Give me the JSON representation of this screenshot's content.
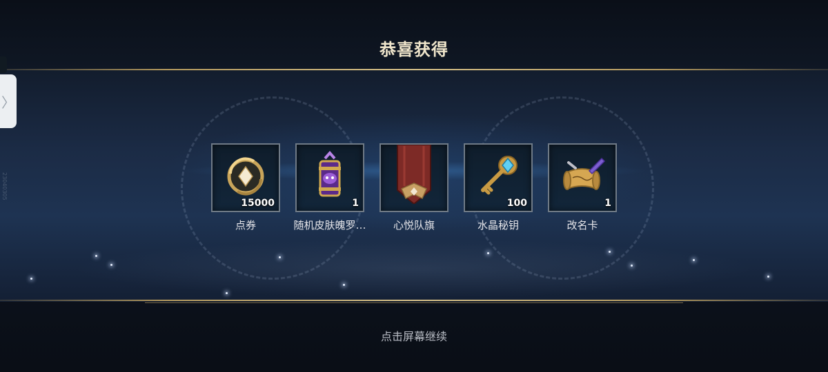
{
  "dialog": {
    "title": "恭喜获得",
    "continue_hint": "点击屏幕继续"
  },
  "watermark": "23040305",
  "side_tab": {
    "icon": "chevron-right-icon",
    "glyph": "〉"
  },
  "rewards": [
    {
      "name": "点券",
      "count": "15000",
      "icon": "coupon-coin-icon"
    },
    {
      "name": "随机皮肤魄罗…",
      "count": "1",
      "icon": "random-skin-poro-icon"
    },
    {
      "name": "心悦队旗",
      "count": "",
      "icon": "team-banner-icon"
    },
    {
      "name": "水晶秘钥",
      "count": "100",
      "icon": "crystal-key-icon"
    },
    {
      "name": "改名卡",
      "count": "1",
      "icon": "rename-scroll-icon"
    }
  ],
  "colors": {
    "title": "#f0e6cc",
    "gold_line": "#d8c28a",
    "frame_border": "#6f7a86",
    "label": "#e6e6ea",
    "hint": "#b8bcc4"
  }
}
